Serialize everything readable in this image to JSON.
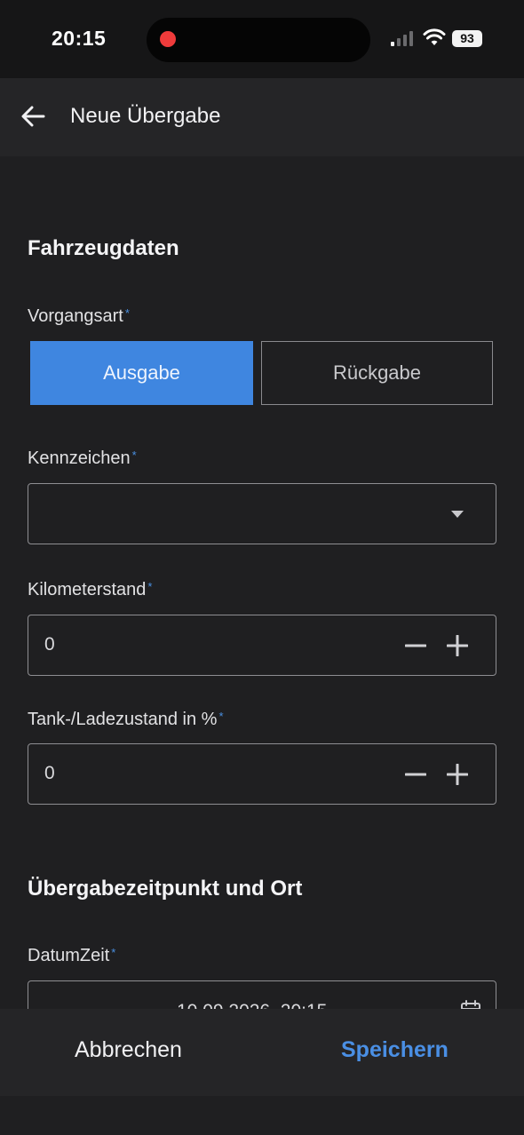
{
  "status_bar": {
    "time": "20:15",
    "battery": "93",
    "icons": [
      "recording-dot-icon",
      "cellular-signal-icon",
      "wifi-icon",
      "battery-icon"
    ]
  },
  "app_bar": {
    "title": "Neue Übergabe",
    "back_icon": "arrow-left-icon"
  },
  "sections": {
    "vehicle": "Fahrzeugdaten",
    "handover": "Übergabezeitpunkt und Ort"
  },
  "fields": {
    "vorgangsart": {
      "label": "Vorgangsart",
      "required": "*",
      "options": [
        "Ausgabe",
        "Rückgabe"
      ],
      "selected": "Ausgabe"
    },
    "kennzeichen": {
      "label": "Kennzeichen",
      "required": "*",
      "value": ""
    },
    "kilometerstand": {
      "label": "Kilometerstand",
      "required": "*",
      "value": "0"
    },
    "tank": {
      "label": "Tank-/Ladezustand in %",
      "required": "*",
      "value": "0"
    },
    "datumzeit": {
      "label": "DatumZeit",
      "required": "*",
      "value": "10.09.2026, 20:15"
    }
  },
  "actions": {
    "cancel": "Abbrechen",
    "save": "Speichern"
  },
  "colors": {
    "accent": "#3f86e0",
    "background": "#1f1f21",
    "bar": "#252527",
    "required": "#4a90e2"
  }
}
